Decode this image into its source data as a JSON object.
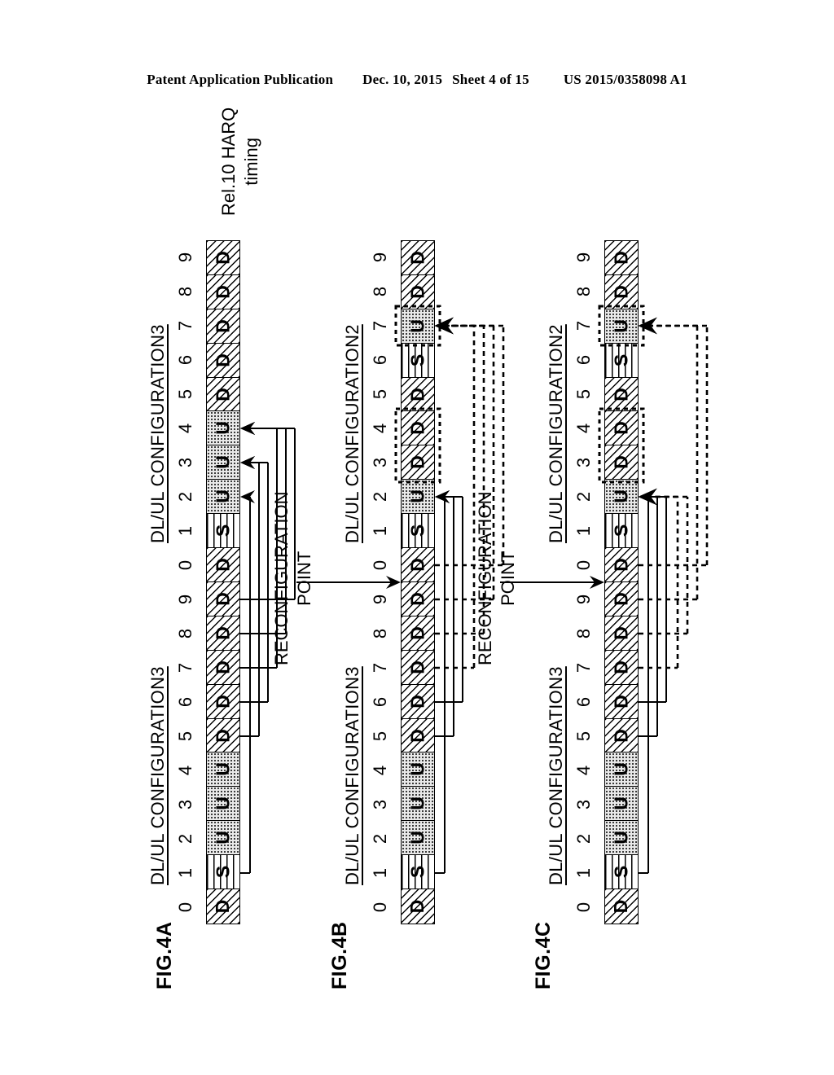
{
  "header": {
    "publication": "Patent Application Publication",
    "date": "Dec. 10, 2015",
    "sheet": "Sheet 4 of 15",
    "docnum": "US 2015/0358098 A1"
  },
  "figures": [
    {
      "id": "fig4a",
      "label": "FIG.4A",
      "left_config_label": "DL/UL CONFIGURATION3",
      "right_config_label": "DL/UL CONFIGURATION3",
      "side_note_line1": "Rel.10 HARQ",
      "side_note_line2": "timing",
      "indices": [
        "0",
        "1",
        "2",
        "3",
        "4",
        "5",
        "6",
        "7",
        "8",
        "9",
        "0",
        "1",
        "2",
        "3",
        "4",
        "5",
        "6",
        "7",
        "8",
        "9"
      ],
      "cells": [
        "D",
        "S",
        "U",
        "U",
        "U",
        "D",
        "D",
        "D",
        "D",
        "D",
        "D",
        "S",
        "U",
        "U",
        "U",
        "D",
        "D",
        "D",
        "D",
        "D"
      ],
      "arrows_solid": [
        {
          "from_index": 1,
          "to_index": 12
        },
        {
          "from_index": 5,
          "to_index": 13
        },
        {
          "from_index": 6,
          "to_index": 13
        },
        {
          "from_index": 7,
          "to_index": 14
        },
        {
          "from_index": 8,
          "to_index": 14
        },
        {
          "from_index": 9,
          "to_index": 14
        }
      ],
      "has_reconfiguration_point": false,
      "dotted_boxes": [],
      "arrows_dotted": []
    },
    {
      "id": "fig4b",
      "label": "FIG.4B",
      "left_config_label": "DL/UL CONFIGURATION3",
      "right_config_label": "DL/UL CONFIGURATION2",
      "side_note_line1": "",
      "side_note_line2": "",
      "reconf_line1": "RECONFIGURATION",
      "reconf_line2": "POINT",
      "reconf_at_index": 10,
      "indices": [
        "0",
        "1",
        "2",
        "3",
        "4",
        "5",
        "6",
        "7",
        "8",
        "9",
        "0",
        "1",
        "2",
        "3",
        "4",
        "5",
        "6",
        "7",
        "8",
        "9"
      ],
      "cells": [
        "D",
        "S",
        "U",
        "U",
        "U",
        "D",
        "D",
        "D",
        "D",
        "D",
        "D",
        "S",
        "U",
        "D",
        "D",
        "D",
        "S",
        "U",
        "D",
        "D"
      ],
      "arrows_solid": [
        {
          "from_index": 1,
          "to_index": 12
        },
        {
          "from_index": 5,
          "to_index": 12
        },
        {
          "from_index": 6,
          "to_index": 12
        }
      ],
      "arrows_dotted": [
        {
          "from_index": 7,
          "to_index": 17
        },
        {
          "from_index": 8,
          "to_index": 17
        },
        {
          "from_index": 9,
          "to_index": 17
        },
        {
          "from_index": 10,
          "to_index": 17
        }
      ],
      "dotted_boxes": [
        {
          "start_index": 13,
          "end_index": 14
        },
        {
          "start_index": 17,
          "end_index": 17
        }
      ],
      "has_reconfiguration_point": true
    },
    {
      "id": "fig4c",
      "label": "FIG.4C",
      "left_config_label": "DL/UL CONFIGURATION3",
      "right_config_label": "DL/UL CONFIGURATION2",
      "side_note_line1": "",
      "side_note_line2": "",
      "reconf_line1": "RECONFIGURATION",
      "reconf_line2": "POINT",
      "reconf_at_index": 10,
      "indices": [
        "0",
        "1",
        "2",
        "3",
        "4",
        "5",
        "6",
        "7",
        "8",
        "9",
        "0",
        "1",
        "2",
        "3",
        "4",
        "5",
        "6",
        "7",
        "8",
        "9"
      ],
      "cells": [
        "D",
        "S",
        "U",
        "U",
        "U",
        "D",
        "D",
        "D",
        "D",
        "D",
        "D",
        "S",
        "U",
        "D",
        "D",
        "D",
        "S",
        "U",
        "D",
        "D"
      ],
      "arrows_solid": [
        {
          "from_index": 1,
          "to_index": 12
        },
        {
          "from_index": 5,
          "to_index": 12
        },
        {
          "from_index": 6,
          "to_index": 12
        }
      ],
      "arrows_dotted": [
        {
          "from_index": 7,
          "to_index": 12
        },
        {
          "from_index": 8,
          "to_index": 12
        },
        {
          "from_index": 9,
          "to_index": 17
        },
        {
          "from_index": 10,
          "to_index": 17
        }
      ],
      "dotted_boxes": [
        {
          "start_index": 13,
          "end_index": 14
        },
        {
          "start_index": 17,
          "end_index": 17
        }
      ],
      "has_reconfiguration_point": true
    }
  ],
  "legend": {
    "downlink_symbol": "D",
    "special_symbol": "S",
    "uplink_symbol": "U"
  }
}
